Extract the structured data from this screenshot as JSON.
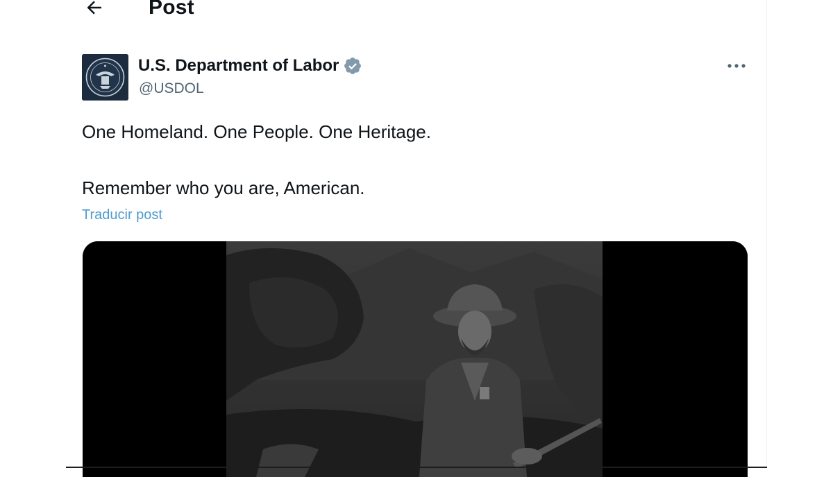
{
  "header": {
    "back_icon": "arrow-left-icon",
    "title": "Post"
  },
  "post": {
    "author": {
      "name": "U.S. Department of Labor",
      "handle": "@USDOL",
      "verified_badge_icon": "verified-badge-icon",
      "avatar": "department-seal-logo"
    },
    "more_icon": "more-horizontal-icon",
    "text_lines": [
      "One Homeland. One People. One Heritage.",
      "Remember who you are, American."
    ],
    "translate_label": "Traducir post",
    "media": {
      "type": "video-thumbnail",
      "description_icon": "frontiersman-painting-image"
    }
  },
  "colors": {
    "text_primary": "#0f1419",
    "text_secondary": "#536471",
    "link": "#4f9ccf",
    "verified_badge": "#829aab",
    "media_background": "#000000"
  }
}
